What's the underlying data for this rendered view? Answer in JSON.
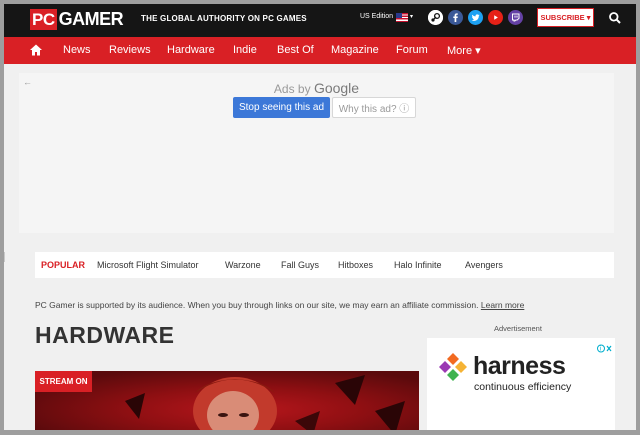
{
  "header": {
    "logo_pc": "PC",
    "logo_gamer": "GAMER",
    "tagline": "THE GLOBAL AUTHORITY ON PC GAMES",
    "edition": "US Edition",
    "edition_caret": "▾",
    "subscribe": "SUBSCRIBE ▾",
    "social_icons": [
      "steam-icon",
      "facebook-icon",
      "twitter-icon",
      "youtube-icon",
      "twitch-icon"
    ],
    "brand_color": "#d92025"
  },
  "nav": {
    "items": [
      "News",
      "Reviews",
      "Hardware",
      "Indie",
      "Best Of",
      "Magazine",
      "Forum",
      "More ▾"
    ]
  },
  "ad": {
    "back": "←",
    "ads_by": "Ads by",
    "google": "Google",
    "stop": "Stop seeing this ad",
    "why": "Why this ad? ⓘ"
  },
  "popular": {
    "label": "POPULAR",
    "tags": [
      "Microsoft Flight Simulator",
      "Warzone",
      "Fall Guys",
      "Hitboxes",
      "Halo Infinite",
      "Avengers"
    ]
  },
  "affiliate": {
    "text": "PC Gamer is supported by its audience. When you buy through links on our site, we may earn an affiliate commission.",
    "link": "Learn more"
  },
  "page": {
    "title": "HARDWARE",
    "advertisement": "Advertisement",
    "stream_badge": "STREAM ON"
  },
  "harness_ad": {
    "name": "harness",
    "tagline": "continuous efficiency"
  }
}
